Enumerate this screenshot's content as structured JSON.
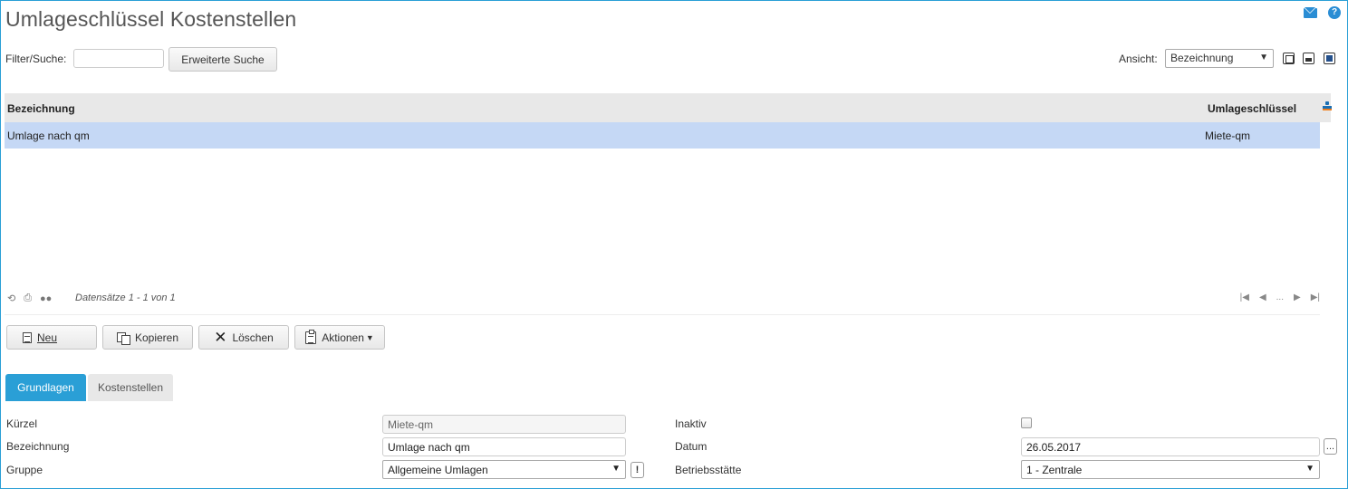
{
  "page": {
    "title": "Umlageschlüssel Kostenstellen"
  },
  "filter": {
    "label": "Filter/Suche:",
    "value": "",
    "extended_search_label": "Erweiterte Suche"
  },
  "view": {
    "label": "Ansicht:",
    "selected": "Bezeichnung"
  },
  "grid": {
    "columns": [
      "Bezeichnung",
      "Umlageschlüssel"
    ],
    "rows": [
      {
        "bezeichnung": "Umlage nach qm",
        "umlageschluessel": "Miete-qm"
      }
    ],
    "records_text": "Datensätze 1 - 1 von 1",
    "pager_ellipsis": "..."
  },
  "toolbar": {
    "new": "Neu",
    "copy": "Kopieren",
    "delete": "Löschen",
    "actions": "Aktionen"
  },
  "tabs": [
    {
      "label": "Grundlagen",
      "active": true
    },
    {
      "label": "Kostenstellen",
      "active": false
    }
  ],
  "form": {
    "kuerzel": {
      "label": "Kürzel",
      "value": "Miete-qm"
    },
    "bezeichnung": {
      "label": "Bezeichnung",
      "value": "Umlage nach qm"
    },
    "gruppe": {
      "label": "Gruppe",
      "value": "Allgemeine Umlagen"
    },
    "inaktiv": {
      "label": "Inaktiv",
      "checked": false
    },
    "datum": {
      "label": "Datum",
      "value": "26.05.2017",
      "picker_label": "..."
    },
    "betriebsstaette": {
      "label": "Betriebsstätte",
      "value": "1 - Zentrale"
    },
    "gruppe_info_label": "!"
  },
  "colors": {
    "accent": "#2a9fd6",
    "selected_row": "#c5d8f5",
    "header_bg": "#e8e8e8"
  },
  "icons": [
    "mail-icon",
    "help-icon",
    "refresh-icon",
    "print-icon",
    "toggle-icon",
    "grid-settings-icon",
    "new-doc-icon",
    "copy-icon",
    "delete-icon",
    "actions-icon"
  ]
}
